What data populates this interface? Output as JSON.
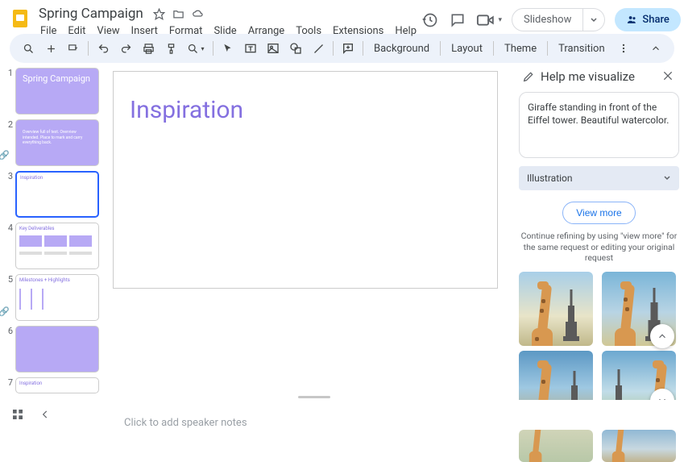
{
  "header": {
    "doc_title": "Spring Campaign",
    "menus": [
      "File",
      "Edit",
      "View",
      "Insert",
      "Format",
      "Slide",
      "Arrange",
      "Tools",
      "Extensions",
      "Help"
    ],
    "slideshow_label": "Slideshow",
    "share_label": "Share"
  },
  "toolbar": {
    "background": "Background",
    "layout": "Layout",
    "theme": "Theme",
    "transition": "Transition"
  },
  "thumbnails": [
    {
      "num": "1",
      "kind": "title",
      "title": "Spring Campaign"
    },
    {
      "num": "2",
      "kind": "text"
    },
    {
      "num": "3",
      "kind": "heading",
      "title": "Inspiration",
      "active": true
    },
    {
      "num": "4",
      "kind": "boxes",
      "title": "Key Deliverables"
    },
    {
      "num": "5",
      "kind": "milestones",
      "title": "Milestones + Highlights"
    },
    {
      "num": "6",
      "kind": "purple"
    },
    {
      "num": "7",
      "kind": "heading",
      "title": "Inspiration"
    }
  ],
  "slide": {
    "title": "Inspiration"
  },
  "notes": {
    "placeholder": "Click to add speaker notes"
  },
  "sidepanel": {
    "title": "Help me visualize",
    "prompt": "Giraffe standing in front of the Eiffel tower. Beautiful watercolor.",
    "style": "Illustration",
    "viewmore": "View more",
    "refine": "Continue refining by using \"view more\" for the same request or editing your original request"
  }
}
